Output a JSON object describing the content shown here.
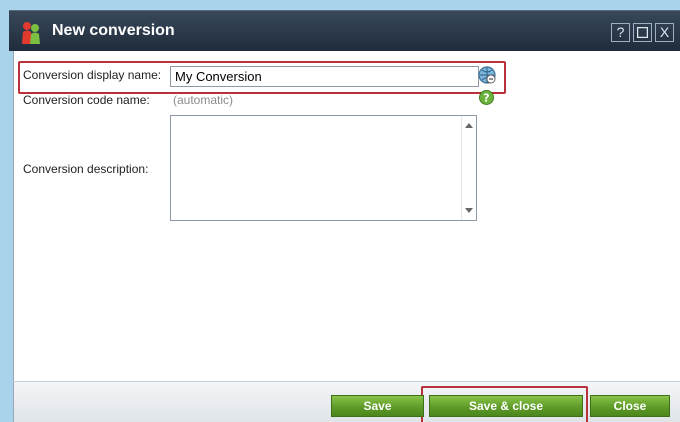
{
  "window": {
    "title": "New conversion",
    "help_label": "?",
    "maximize_label": "□",
    "close_label": "X"
  },
  "form": {
    "display_name_label": "Conversion display name:",
    "display_name_value": "My Conversion",
    "code_name_label": "Conversion code name:",
    "code_name_value": "(automatic)",
    "description_label": "Conversion description:",
    "description_value": ""
  },
  "footer": {
    "save_label": "Save",
    "save_close_label": "Save & close",
    "close_label": "Close"
  },
  "colors": {
    "titlebar": "#1f2c3b",
    "accent_green": "#5e9b28",
    "highlight_red": "#b9313a"
  }
}
